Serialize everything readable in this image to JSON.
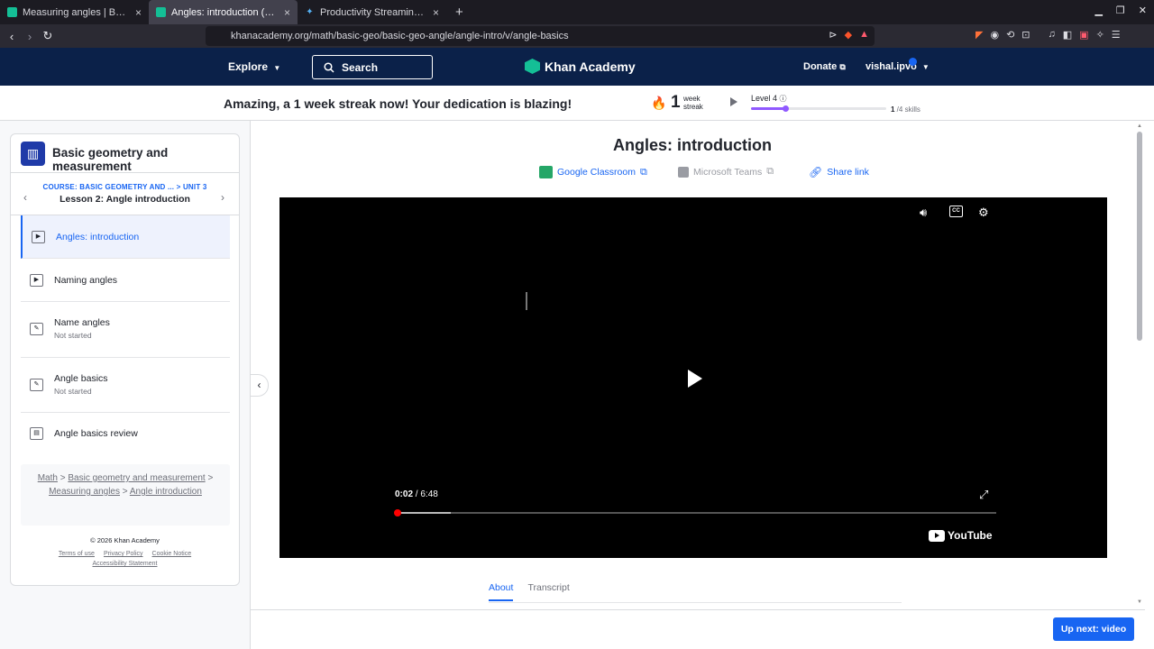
{
  "browser": {
    "tabs": [
      {
        "title": "Measuring angles | Basic geo",
        "active": false
      },
      {
        "title": "Angles: introduction (vide",
        "active": true
      },
      {
        "title": "Productivity Streaming Acco",
        "active": false
      }
    ],
    "new_tab": "+",
    "url": "khanacademy.org/math/basic-geo/basic-geo-angle/angle-intro/v/angle-basics"
  },
  "header": {
    "explore": "Explore",
    "search_label": "Search",
    "logo": "Khan Academy",
    "donate": "Donate",
    "username": "vishal.ipvo"
  },
  "streak": {
    "message": "Amazing, a 1 week streak now! Your dedication is blazing!",
    "count": "1",
    "unit_line1": "week",
    "unit_line2": "streak",
    "level": "Level 4",
    "skills_done": "1",
    "skills_total": " /4 skills",
    "level_progress": 0.25
  },
  "sidebar": {
    "course_title": "Basic geometry and measurement",
    "course_crumb": "COURSE: BASIC GEOMETRY AND ... > UNIT 3",
    "lesson": "Lesson 2: Angle introduction",
    "items": [
      {
        "label": "Angles: introduction",
        "status": "",
        "type": "video"
      },
      {
        "label": "Naming angles",
        "status": "",
        "type": "video"
      },
      {
        "label": "Name angles",
        "status": "Not started",
        "type": "exercise"
      },
      {
        "label": "Angle basics",
        "status": "Not started",
        "type": "exercise"
      },
      {
        "label": "Angle basics review",
        "status": "",
        "type": "article"
      }
    ],
    "breadcrumb": {
      "math": "Math",
      "course": "Basic geometry and measurement",
      "unit": "Measuring angles",
      "lesson": "Angle introduction",
      "sep": ">"
    },
    "copyright": "© 2026 Khan Academy",
    "footer_links": {
      "terms": "Terms of use",
      "privacy": "Privacy Policy",
      "cookie": "Cookie Notice",
      "accessibility": "Accessibility Statement"
    }
  },
  "main": {
    "title": "Angles: introduction",
    "share": {
      "google": "Google Classroom",
      "teams": "Microsoft Teams",
      "link": "Share link"
    },
    "player": {
      "current_time": "0:02",
      "duration": " / 6:48",
      "played_fraction": 0.005,
      "buffered_fraction": 0.093,
      "provider": "YouTube"
    },
    "tabs": [
      "About",
      "Transcript"
    ],
    "up_next": "Up next: video"
  },
  "colors": {
    "ka_navy": "#0b2149",
    "ka_blue": "#1865f2",
    "ka_green": "#14bf96",
    "level_purple": "#9059ff"
  }
}
